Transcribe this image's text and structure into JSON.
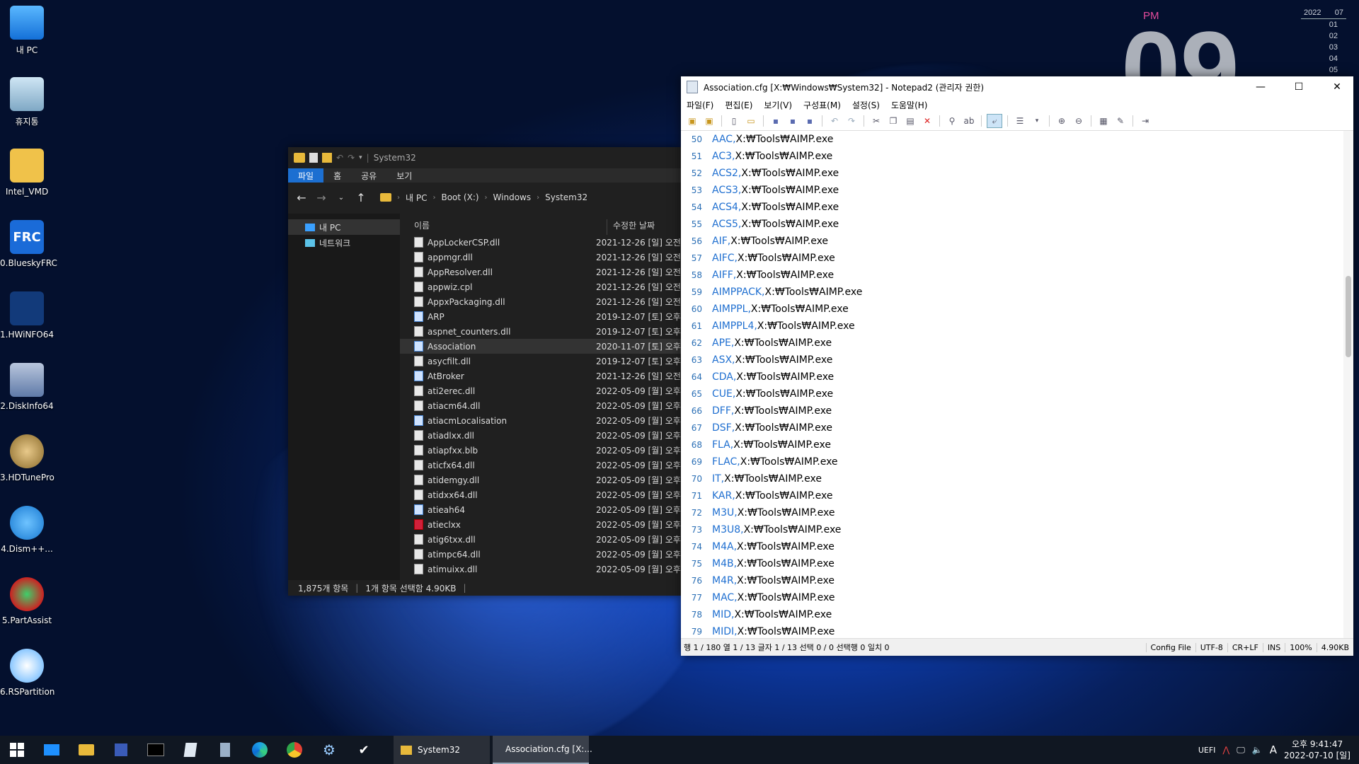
{
  "desktop": {
    "icons": [
      {
        "label": "내 PC",
        "icon": "computer-icon"
      },
      {
        "label": "휴지통",
        "icon": "recycle-bin-icon"
      },
      {
        "label": "Intel_VMD",
        "icon": "folder-icon"
      },
      {
        "label": "0.BlueskyFRC",
        "icon": "frc-icon",
        "badge": "FRC"
      },
      {
        "label": "1.HWiNFO64",
        "icon": "hwinfo-icon"
      },
      {
        "label": "2.DiskInfo64",
        "icon": "diskinfo-icon"
      },
      {
        "label": "3.HDTunePro",
        "icon": "hdtune-icon"
      },
      {
        "label": "4.Dism++...",
        "icon": "gears-icon"
      },
      {
        "label": "5.PartAssist",
        "icon": "partassist-icon"
      },
      {
        "label": "6.RSPartition",
        "icon": "rspartition-icon"
      }
    ]
  },
  "widget": {
    "ampm": "PM",
    "bigtime": "09",
    "cal_year": "2022",
    "cal_month": "07",
    "cal_days": [
      "01",
      "02",
      "03",
      "04",
      "05"
    ]
  },
  "explorer": {
    "title": "System32",
    "ribbon_tabs": [
      "파일",
      "홈",
      "공유",
      "보기"
    ],
    "breadcrumb": [
      "내 PC",
      "Boot (X:)",
      "Windows",
      "System32"
    ],
    "nav_items": [
      "내 PC",
      "네트워크"
    ],
    "col_name": "이름",
    "col_date": "수정한 날짜",
    "files": [
      {
        "name": "AppLockerCSP.dll",
        "date": "2021-12-26 [일] 오전",
        "type": "dll"
      },
      {
        "name": "appmgr.dll",
        "date": "2021-12-26 [일] 오전",
        "type": "dll"
      },
      {
        "name": "AppResolver.dll",
        "date": "2021-12-26 [일] 오전",
        "type": "dll"
      },
      {
        "name": "appwiz.cpl",
        "date": "2021-12-26 [일] 오전",
        "type": "dll"
      },
      {
        "name": "AppxPackaging.dll",
        "date": "2021-12-26 [일] 오전",
        "type": "dll"
      },
      {
        "name": "ARP",
        "date": "2019-12-07 [토] 오후",
        "type": "app"
      },
      {
        "name": "aspnet_counters.dll",
        "date": "2019-12-07 [토] 오후",
        "type": "dll"
      },
      {
        "name": "Association",
        "date": "2020-11-07 [토] 오후",
        "type": "cfg"
      },
      {
        "name": "asycfilt.dll",
        "date": "2019-12-07 [토] 오후",
        "type": "dll"
      },
      {
        "name": "AtBroker",
        "date": "2021-12-26 [일] 오전",
        "type": "app"
      },
      {
        "name": "ati2erec.dll",
        "date": "2022-05-09 [월] 오후",
        "type": "dll"
      },
      {
        "name": "atiacm64.dll",
        "date": "2022-05-09 [월] 오후",
        "type": "dll"
      },
      {
        "name": "atiacmLocalisation",
        "date": "2022-05-09 [월] 오후",
        "type": "cfg"
      },
      {
        "name": "atiadlxx.dll",
        "date": "2022-05-09 [월] 오후",
        "type": "dll"
      },
      {
        "name": "atiapfxx.blb",
        "date": "2022-05-09 [월] 오후",
        "type": "file"
      },
      {
        "name": "aticfx64.dll",
        "date": "2022-05-09 [월] 오후",
        "type": "dll"
      },
      {
        "name": "atidemgy.dll",
        "date": "2022-05-09 [월] 오후",
        "type": "dll"
      },
      {
        "name": "atidxx64.dll",
        "date": "2022-05-09 [월] 오후",
        "type": "dll"
      },
      {
        "name": "atieah64",
        "date": "2022-05-09 [월] 오후",
        "type": "app"
      },
      {
        "name": "atieclxx",
        "date": "2022-05-09 [월] 오후",
        "type": "red"
      },
      {
        "name": "atig6txx.dll",
        "date": "2022-05-09 [월] 오후",
        "type": "dll"
      },
      {
        "name": "atimpc64.dll",
        "date": "2022-05-09 [월] 오후",
        "type": "dll"
      },
      {
        "name": "atimuixx.dll",
        "date": "2022-05-09 [월] 오후",
        "type": "dll"
      }
    ],
    "selected_file": "Association",
    "status_count": "1,875개 항목",
    "status_selected": "1개 항목 선택함 4.90KB"
  },
  "notepad": {
    "title": "Association.cfg [X:₩Windows₩System32] - Notepad2 (관리자 권한)",
    "menu": [
      "파일(F)",
      "편집(E)",
      "보기(V)",
      "구성표(M)",
      "설정(S)",
      "도움말(H)"
    ],
    "lines": [
      {
        "num": "50",
        "key": "AAC,",
        "rest": "X:₩Tools₩AIMP.exe"
      },
      {
        "num": "51",
        "key": "AC3,",
        "rest": "X:₩Tools₩AIMP.exe"
      },
      {
        "num": "52",
        "key": "ACS2,",
        "rest": "X:₩Tools₩AIMP.exe"
      },
      {
        "num": "53",
        "key": "ACS3,",
        "rest": "X:₩Tools₩AIMP.exe"
      },
      {
        "num": "54",
        "key": "ACS4,",
        "rest": "X:₩Tools₩AIMP.exe"
      },
      {
        "num": "55",
        "key": "ACS5,",
        "rest": "X:₩Tools₩AIMP.exe"
      },
      {
        "num": "56",
        "key": "AIF,",
        "rest": "X:₩Tools₩AIMP.exe"
      },
      {
        "num": "57",
        "key": "AIFC,",
        "rest": "X:₩Tools₩AIMP.exe"
      },
      {
        "num": "58",
        "key": "AIFF,",
        "rest": "X:₩Tools₩AIMP.exe"
      },
      {
        "num": "59",
        "key": "AIMPPACK,",
        "rest": "X:₩Tools₩AIMP.exe"
      },
      {
        "num": "60",
        "key": "AIMPPL,",
        "rest": "X:₩Tools₩AIMP.exe"
      },
      {
        "num": "61",
        "key": "AIMPPL4,",
        "rest": "X:₩Tools₩AIMP.exe"
      },
      {
        "num": "62",
        "key": "APE,",
        "rest": "X:₩Tools₩AIMP.exe"
      },
      {
        "num": "63",
        "key": "ASX,",
        "rest": "X:₩Tools₩AIMP.exe"
      },
      {
        "num": "64",
        "key": "CDA,",
        "rest": "X:₩Tools₩AIMP.exe"
      },
      {
        "num": "65",
        "key": "CUE,",
        "rest": "X:₩Tools₩AIMP.exe"
      },
      {
        "num": "66",
        "key": "DFF,",
        "rest": "X:₩Tools₩AIMP.exe"
      },
      {
        "num": "67",
        "key": "DSF,",
        "rest": "X:₩Tools₩AIMP.exe"
      },
      {
        "num": "68",
        "key": "FLA,",
        "rest": "X:₩Tools₩AIMP.exe"
      },
      {
        "num": "69",
        "key": "FLAC,",
        "rest": "X:₩Tools₩AIMP.exe"
      },
      {
        "num": "70",
        "key": "IT,",
        "rest": "X:₩Tools₩AIMP.exe"
      },
      {
        "num": "71",
        "key": "KAR,",
        "rest": "X:₩Tools₩AIMP.exe"
      },
      {
        "num": "72",
        "key": "M3U,",
        "rest": "X:₩Tools₩AIMP.exe"
      },
      {
        "num": "73",
        "key": "M3U8,",
        "rest": "X:₩Tools₩AIMP.exe"
      },
      {
        "num": "74",
        "key": "M4A,",
        "rest": "X:₩Tools₩AIMP.exe"
      },
      {
        "num": "75",
        "key": "M4B,",
        "rest": "X:₩Tools₩AIMP.exe"
      },
      {
        "num": "76",
        "key": "M4R,",
        "rest": "X:₩Tools₩AIMP.exe"
      },
      {
        "num": "77",
        "key": "MAC,",
        "rest": "X:₩Tools₩AIMP.exe"
      },
      {
        "num": "78",
        "key": "MID,",
        "rest": "X:₩Tools₩AIMP.exe"
      },
      {
        "num": "79",
        "key": "MIDI,",
        "rest": "X:₩Tools₩AIMP.exe"
      }
    ],
    "status": {
      "position": "행 1 / 180  열 1 / 13  글자 1 / 13  선택 0 / 0  선택행 0  일치 0",
      "scheme": "Config File",
      "encoding": "UTF-8",
      "eol": "CR+LF",
      "mode": "INS",
      "zoom": "100%",
      "size": "4.90KB"
    }
  },
  "taskbar": {
    "tasks": [
      {
        "label": "System32",
        "icon": "folder-icon"
      },
      {
        "label": "Association.cfg [X:...",
        "icon": "notepad-icon"
      }
    ],
    "tray_text": "UEFI",
    "ime": "A",
    "time": "오후 9:41:47",
    "date": "2022-07-10 [일]"
  },
  "colors": {
    "accent": "#1c6fd1",
    "keyword": "#1f6fd0",
    "line_number": "#2b6fb5",
    "pm": "#e24a9b"
  }
}
